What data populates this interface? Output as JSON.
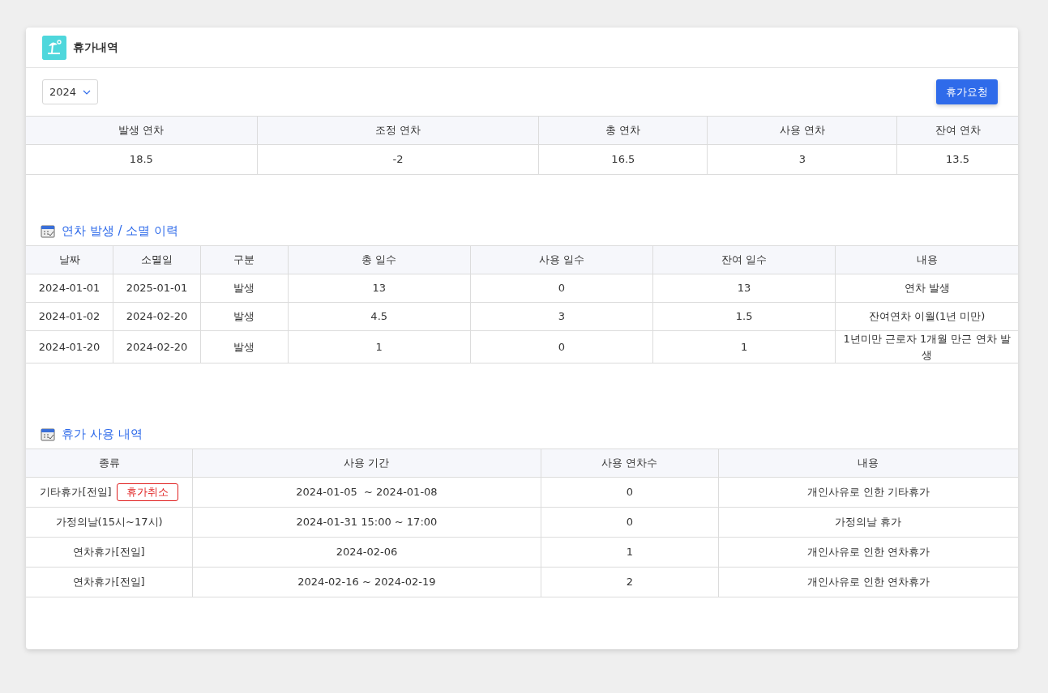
{
  "title": "휴가내역",
  "year_select": {
    "value": "2024"
  },
  "request_button": "휴가요청",
  "summary": {
    "columns": [
      "발생 연차",
      "조정 연차",
      "총 연차",
      "사용 연차",
      "잔여 연차"
    ],
    "values": [
      "18.5",
      "-2",
      "16.5",
      "3",
      "13.5"
    ]
  },
  "history": {
    "title": "연차 발생 / 소멸 이력",
    "columns": [
      "날짜",
      "소멸일",
      "구분",
      "총 일수",
      "사용 일수",
      "잔여 일수",
      "내용"
    ],
    "rows": [
      [
        "2024-01-01",
        "2025-01-01",
        "발생",
        "13",
        "0",
        "13",
        "연차 발생"
      ],
      [
        "2024-01-02",
        "2024-02-20",
        "발생",
        "4.5",
        "3",
        "1.5",
        "잔여연차 이월(1년 미만)"
      ],
      [
        "2024-01-20",
        "2024-02-20",
        "발생",
        "1",
        "0",
        "1",
        "1년미만 근로자 1개월 만근 연차 발생"
      ]
    ]
  },
  "usage": {
    "title": "휴가 사용 내역",
    "columns": [
      "종류",
      "사용 기간",
      "사용 연차수",
      "내용"
    ],
    "rows": [
      {
        "type": "기타휴가[전일]",
        "cancel_button": "휴가취소",
        "period": "2024-01-05  ~ 2024-01-08",
        "days": "0",
        "note": "개인사유로 인한 기타휴가"
      },
      {
        "type": "가정의날(15시~17시)",
        "period": "2024-01-31 15:00 ~ 17:00",
        "days": "0",
        "note": "가정의날 휴가"
      },
      {
        "type": "연차휴가[전일]",
        "period": "2024-02-06",
        "days": "1",
        "note": "개인사유로 인한 연차휴가"
      },
      {
        "type": "연차휴가[전일]",
        "period": "2024-02-16 ~ 2024-02-19",
        "days": "2",
        "note": "개인사유로 인한 연차휴가"
      }
    ]
  }
}
